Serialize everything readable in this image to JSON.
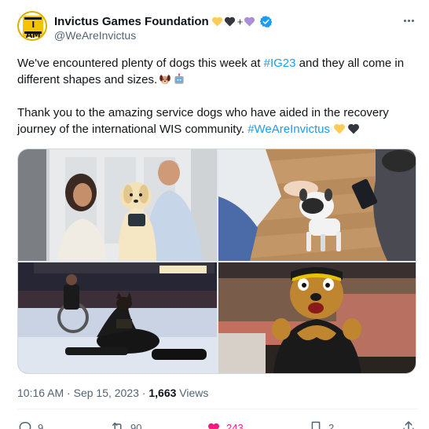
{
  "author": {
    "display_name": "Invictus Games Foundation",
    "handle": "@WeAreInvictus",
    "verified": true,
    "avatar_text": "I AM",
    "name_emoji": [
      "yellow-heart",
      "black-heart",
      "+",
      "purple-heart"
    ]
  },
  "post": {
    "paragraph1_text": "We've encountered plenty of dogs this week at ",
    "paragraph1_hashtag": "#IG23",
    "paragraph1_rest": " and they all come in different shapes and sizes.",
    "paragraph1_emoji": [
      "dog-face",
      "robot-face"
    ],
    "paragraph2_text": "Thank you to the amazing service dogs who have aided in the recovery journey of the international WIS community. ",
    "paragraph2_hashtag": "#WeAreInvictus",
    "paragraph2_emoji": [
      "yellow-heart",
      "black-heart"
    ]
  },
  "media": [
    {
      "description_icon": "photo-couple-with-golden-dog"
    },
    {
      "description_icon": "photo-robot-dog"
    },
    {
      "description_icon": "photo-service-dog-wheelchair-court"
    },
    {
      "description_icon": "photo-mascot-dog"
    }
  ],
  "meta": {
    "time": "10:16 AM",
    "separator": "·",
    "date": "Sep 15, 2023",
    "views_count": "1,663",
    "views_label": "Views"
  },
  "actions": {
    "reply_count": "9",
    "retweet_count": "90",
    "like_count": "243",
    "bookmark_count": "2"
  },
  "colors": {
    "accent": "#1d9bf0",
    "like": "#f91880",
    "muted": "#536471"
  }
}
